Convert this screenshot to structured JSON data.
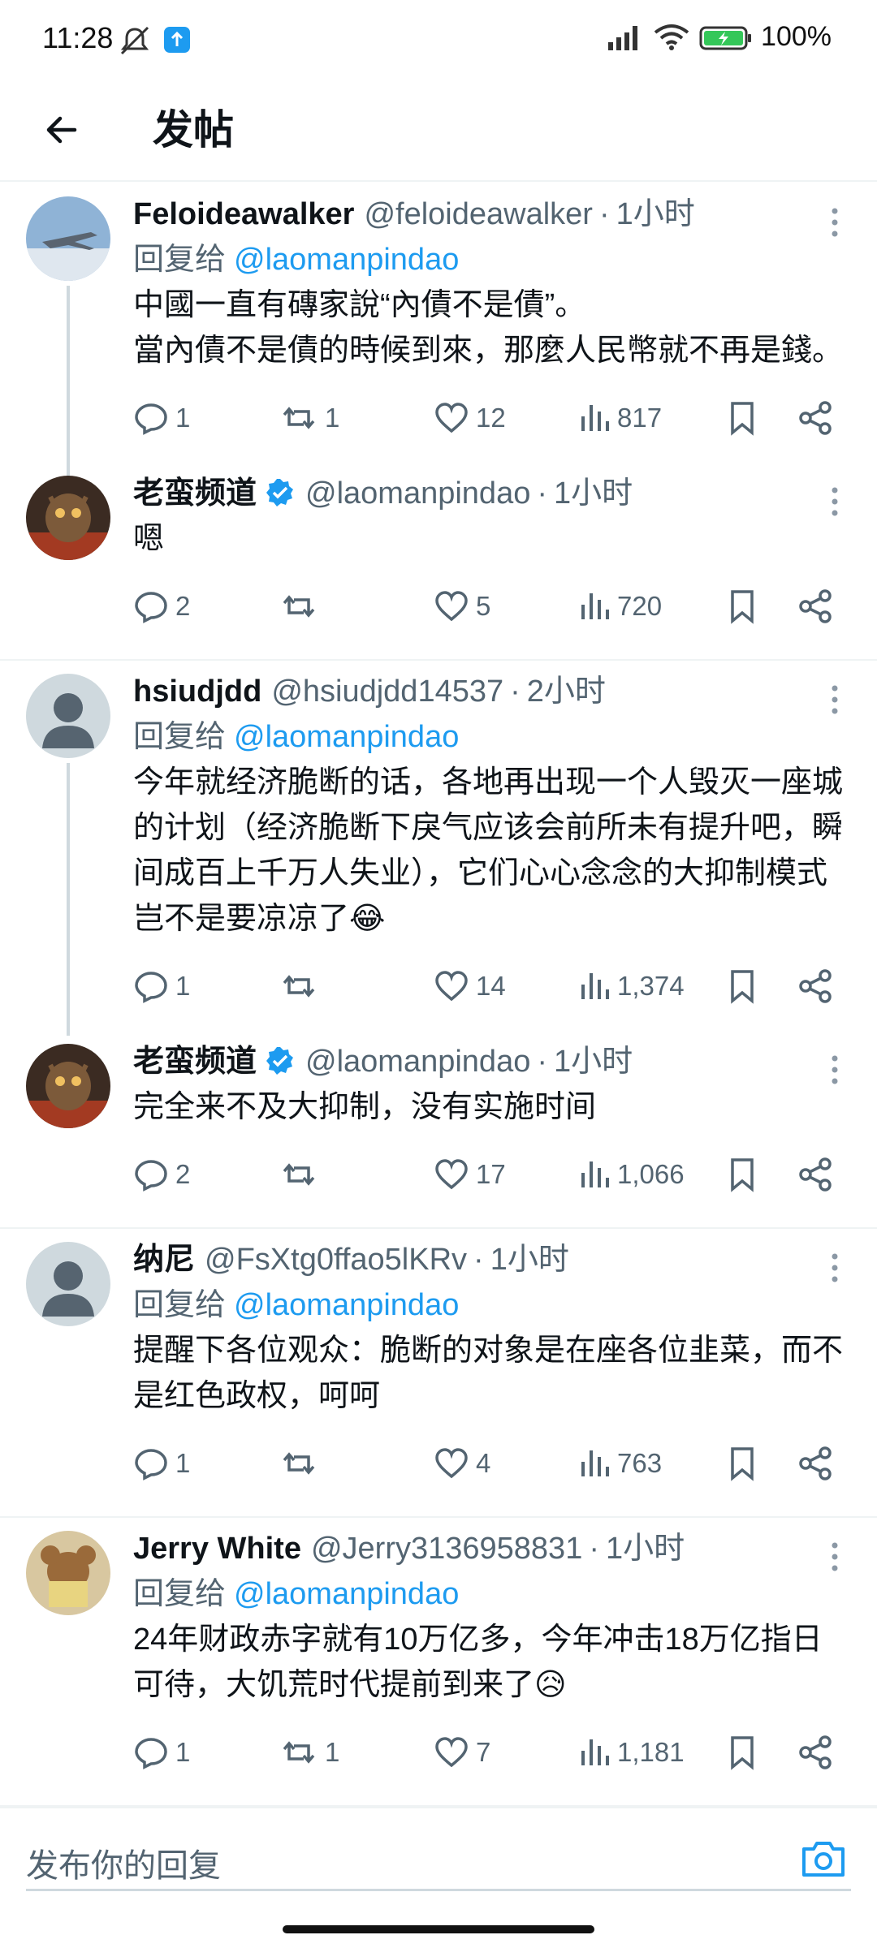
{
  "status_bar": {
    "time": "11:28",
    "battery": "100%"
  },
  "header": {
    "title": "发帖"
  },
  "threads": [
    {
      "tweets": [
        {
          "name": "Feloideawalker",
          "handle": "@feloideawalker",
          "time": "1小时",
          "reply_prefix": "回复给",
          "reply_to": "@laomanpindao",
          "text": "中國一直有磚家說“內債不是債”。\n當內債不是債的時候到來，那麼人民幣就不再是錢。",
          "replies": "1",
          "retweets": "1",
          "likes": "12",
          "views": "817"
        },
        {
          "name": "老蛮频道",
          "handle": "@laomanpindao",
          "time": "1小时",
          "text": "嗯",
          "replies": "2",
          "retweets": "",
          "likes": "5",
          "views": "720"
        }
      ]
    },
    {
      "tweets": [
        {
          "name": "hsiudjdd",
          "handle": "@hsiudjdd14537",
          "time": "2小时",
          "reply_prefix": "回复给",
          "reply_to": "@laomanpindao",
          "text": "今年就经济脆断的话，各地再出现一个人毁灭一座城的计划（经济脆断下戾气应该会前所未有提升吧，瞬间成百上千万人失业），它们心心念念的大抑制模式岂不是要凉凉了😂",
          "replies": "1",
          "retweets": "",
          "likes": "14",
          "views": "1,374"
        },
        {
          "name": "老蛮频道",
          "handle": "@laomanpindao",
          "time": "1小时",
          "text": "完全来不及大抑制，没有实施时间",
          "replies": "2",
          "retweets": "",
          "likes": "17",
          "views": "1,066"
        }
      ]
    },
    {
      "tweets": [
        {
          "name": "纳尼",
          "handle": "@FsXtg0ffao5lKRv",
          "time": "1小时",
          "reply_prefix": "回复给",
          "reply_to": "@laomanpindao",
          "text": "提醒下各位观众：脆断的对象是在座各位韭菜，而不是红色政权，呵呵",
          "replies": "1",
          "retweets": "",
          "likes": "4",
          "views": "763"
        }
      ]
    },
    {
      "tweets": [
        {
          "name": "Jerry White",
          "handle": "@Jerry3136958831",
          "time": "1小时",
          "reply_prefix": "回复给",
          "reply_to": "@laomanpindao",
          "text": "24年财政赤字就有10万亿多，今年冲击18万亿指日可待，大饥荒时代提前到来了😥",
          "replies": "1",
          "retweets": "1",
          "likes": "7",
          "views": "1,181"
        }
      ]
    }
  ],
  "composer": {
    "placeholder": "发布你的回复"
  },
  "colors": {
    "accent": "#1d9bf0",
    "secondary_text": "#536471",
    "divider": "#eff3f4"
  }
}
